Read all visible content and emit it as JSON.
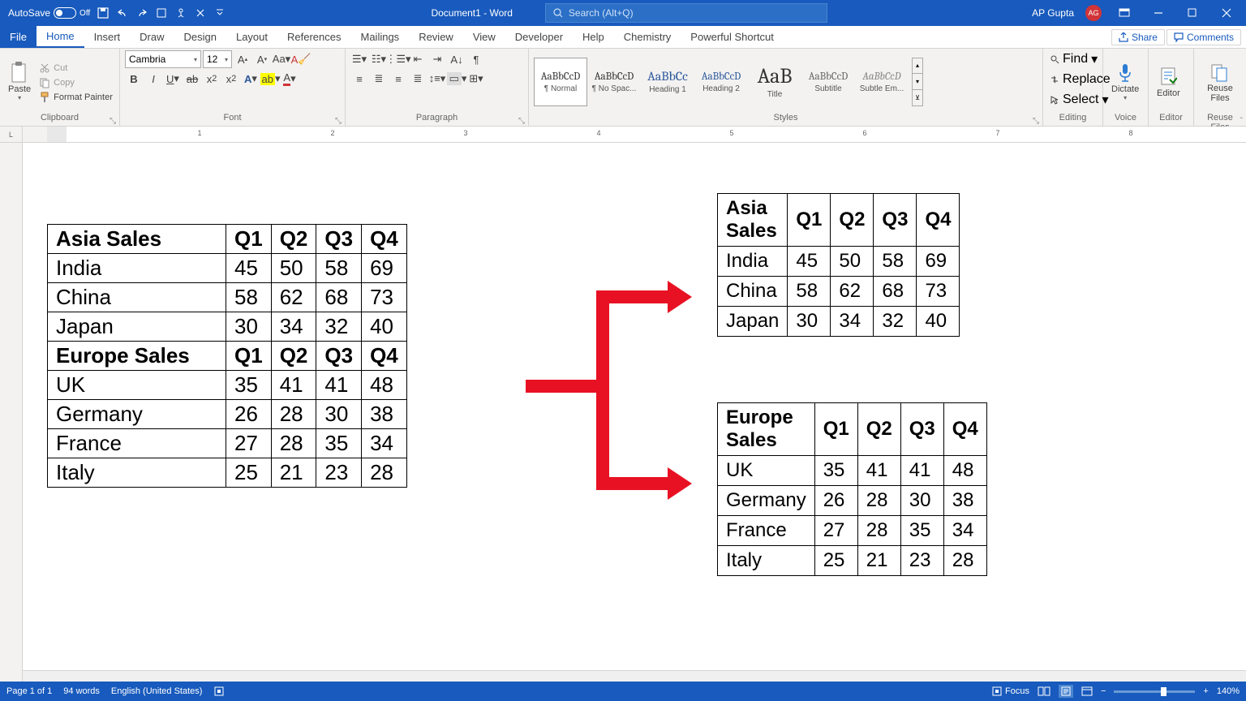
{
  "title_bar": {
    "autosave_label": "AutoSave",
    "autosave_state": "Off",
    "doc_title": "Document1 - Word",
    "search_placeholder": "Search (Alt+Q)",
    "user_name": "AP Gupta",
    "user_initials": "AG"
  },
  "tabs": {
    "file": "File",
    "home": "Home",
    "insert": "Insert",
    "draw": "Draw",
    "design": "Design",
    "layout": "Layout",
    "references": "References",
    "mailings": "Mailings",
    "review": "Review",
    "view": "View",
    "developer": "Developer",
    "help": "Help",
    "chemistry": "Chemistry",
    "shortcut": "Powerful Shortcut",
    "share": "Share",
    "comments": "Comments"
  },
  "ribbon": {
    "clipboard": {
      "label": "Clipboard",
      "paste": "Paste",
      "cut": "Cut",
      "copy": "Copy",
      "format_painter": "Format Painter"
    },
    "font": {
      "label": "Font",
      "name": "Cambria",
      "size": "12"
    },
    "paragraph": {
      "label": "Paragraph"
    },
    "styles": {
      "label": "Styles",
      "items": [
        {
          "preview": "AaBbCcD",
          "name": "¶ Normal"
        },
        {
          "preview": "AaBbCcD",
          "name": "¶ No Spac..."
        },
        {
          "preview": "AaBbCc",
          "name": "Heading 1"
        },
        {
          "preview": "AaBbCcD",
          "name": "Heading 2"
        },
        {
          "preview": "AaB",
          "name": "Title"
        },
        {
          "preview": "AaBbCcD",
          "name": "Subtitle"
        },
        {
          "preview": "AaBbCcD",
          "name": "Subtle Em..."
        }
      ]
    },
    "editing": {
      "label": "Editing",
      "find": "Find",
      "replace": "Replace",
      "select": "Select"
    },
    "voice": {
      "label": "Voice",
      "dictate": "Dictate"
    },
    "editor": {
      "label": "Editor",
      "btn": "Editor"
    },
    "reuse": {
      "label": "Reuse Files",
      "btn": "Reuse Files"
    }
  },
  "chart_data": [
    {
      "type": "table",
      "title": "Asia Sales",
      "columns": [
        "Q1",
        "Q2",
        "Q3",
        "Q4"
      ],
      "rows": [
        {
          "name": "India",
          "values": [
            45,
            50,
            58,
            69
          ]
        },
        {
          "name": "China",
          "values": [
            58,
            62,
            68,
            73
          ]
        },
        {
          "name": "Japan",
          "values": [
            30,
            34,
            32,
            40
          ]
        }
      ]
    },
    {
      "type": "table",
      "title": "Europe Sales",
      "columns": [
        "Q1",
        "Q2",
        "Q3",
        "Q4"
      ],
      "rows": [
        {
          "name": "UK",
          "values": [
            35,
            41,
            41,
            48
          ]
        },
        {
          "name": "Germany",
          "values": [
            26,
            28,
            30,
            38
          ]
        },
        {
          "name": "France",
          "values": [
            27,
            28,
            35,
            34
          ]
        },
        {
          "name": "Italy",
          "values": [
            25,
            21,
            23,
            28
          ]
        }
      ]
    }
  ],
  "status": {
    "page": "Page 1 of 1",
    "words": "94 words",
    "language": "English (United States)",
    "focus": "Focus",
    "zoom": "140%"
  }
}
